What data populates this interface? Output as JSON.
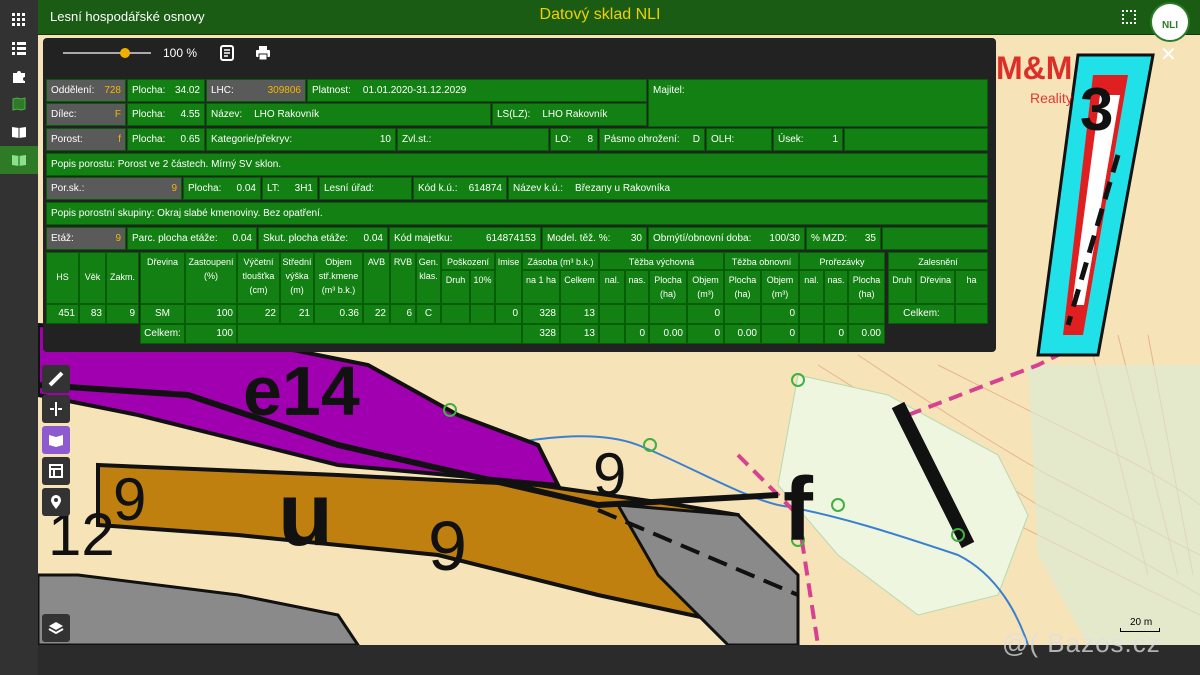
{
  "app": {
    "title": "Lesní hospodářské osnovy",
    "center_title": "Datový sklad NLI",
    "logo_text": "NLI",
    "colors": {
      "accent": "#138013",
      "title": "#f0d000",
      "value": "#f0b800"
    }
  },
  "sidebar": {
    "items": [
      {
        "name": "apps",
        "icon": "grid-icon"
      },
      {
        "name": "list",
        "icon": "list-icon"
      },
      {
        "name": "plugins",
        "icon": "puzzle-icon"
      },
      {
        "name": "map",
        "icon": "map-icon"
      },
      {
        "name": "book",
        "icon": "book-icon"
      },
      {
        "name": "osnovy",
        "icon": "open-book-icon",
        "active": true
      }
    ]
  },
  "dialog": {
    "zoom_label": "100 %",
    "zoom_level": 0.7,
    "close_label": "✕"
  },
  "info": {
    "oddeleni": {
      "label": "Oddělení:",
      "value": "728"
    },
    "plocha1": {
      "label": "Plocha:",
      "value": "34.02"
    },
    "lhc": {
      "label": "LHC:",
      "value": "309806"
    },
    "platnost": {
      "label": "Platnost:",
      "value": "01.01.2020-31.12.2029"
    },
    "majitel": {
      "label": "Majitel:"
    },
    "dilec": {
      "label": "Dílec:",
      "value": "F"
    },
    "plocha2": {
      "label": "Plocha:",
      "value": "4.55"
    },
    "nazev": {
      "label": "Název:",
      "value": "LHO Rakovník"
    },
    "lslz": {
      "label": "LS(LZ):",
      "value": "LHO Rakovník"
    },
    "porost": {
      "label": "Porost:",
      "value": "f"
    },
    "plocha3": {
      "label": "Plocha:",
      "value": "0.65"
    },
    "kategorie": {
      "label": "Kategorie/překryv:",
      "value": "10"
    },
    "zvlst": {
      "label": "Zvl.st.:"
    },
    "lo": {
      "label": "LO:",
      "value": "8"
    },
    "pasmo": {
      "label": "Pásmo ohrožení:",
      "value": "D"
    },
    "olh": {
      "label": "OLH:"
    },
    "usek": {
      "label": "Úsek:",
      "value": "1"
    },
    "popis_porostu": {
      "label": "Popis porostu:",
      "value": "Porost ve 2 částech. Mírný SV sklon."
    },
    "porsk": {
      "label": "Por.sk.:",
      "value": "9"
    },
    "plocha4": {
      "label": "Plocha:",
      "value": "0.04"
    },
    "lt": {
      "label": "LT:",
      "value": "3H1"
    },
    "lesni_urad": {
      "label": "Lesní úřad:"
    },
    "kod_ku": {
      "label": "Kód k.ú.:",
      "value": "614874"
    },
    "nazev_ku": {
      "label": "Název k.ú.:",
      "value": "Březany u Rakovníka"
    },
    "popis_skupiny": {
      "label": "Popis porostní skupiny:",
      "value": "Okraj slabé kmenoviny. Bez opatření."
    },
    "etaz": {
      "label": "Etáž:",
      "value": "9"
    },
    "parc_plocha": {
      "label": "Parc. plocha etáže:",
      "value": "0.04"
    },
    "skut_plocha": {
      "label": "Skut. plocha etáže:",
      "value": "0.04"
    },
    "kod_majetku": {
      "label": "Kód majetku:",
      "value": "614874153"
    },
    "model_tez": {
      "label": "Model. těž. %:",
      "value": "30"
    },
    "obmyti": {
      "label": "Obmýtí/obnovní doba:",
      "value": "100/30"
    },
    "mzd": {
      "label": "% MZD:",
      "value": "35"
    }
  },
  "table": {
    "headers": {
      "hs": "HS",
      "vek": "Věk",
      "zakm": "Zakm.",
      "drevina": "Dřevina",
      "zastoupeni": "Zastoupení (%)",
      "vycetni": "Výčetní tloušťka (cm)",
      "stredni": "Střední výška (m)",
      "objem": "Objem stř.kmene (m³ b.k.)",
      "avb": "AVB",
      "rvb": "RVB",
      "gen": "Gen. klas.",
      "poskozeni": "Poškození",
      "druh": "Druh",
      "pct10": "10%",
      "imise": "Imise",
      "zasoba": "Zásoba (m³ b.k.)",
      "na1ha": "na 1 ha",
      "celkem": "Celkem",
      "tezba_vych": "Těžba výchovná",
      "nal": "nal.",
      "nas": "nas.",
      "plocha_ha": "Plocha (ha)",
      "objem_m3": "Objem (m³)",
      "tezba_obn": "Těžba obnovní",
      "prorezavky": "Prořezávky",
      "zalesneni": "Zalesnění",
      "druh2": "Druh",
      "drevina2": "Dřevina",
      "ha": "ha"
    },
    "hs_row": {
      "hs": "451",
      "vek": "83",
      "zakm": "9"
    },
    "row": {
      "drevina": "SM",
      "zastoupeni": "100",
      "vycetni": "22",
      "stredni": "21",
      "objem": "0.36",
      "avb": "22",
      "rvb": "6",
      "gen": "C",
      "imise": "0",
      "na1ha": "328",
      "celkem": "13",
      "tv_objem": "0",
      "to_objem": "0"
    },
    "total": {
      "label": "Celkem:",
      "zastoupeni": "100",
      "na1ha": "328",
      "celkem": "13",
      "tv_nas": "0",
      "tv_plocha": "0.00",
      "tv_objem": "0",
      "to_plocha": "0.00",
      "to_objem": "0",
      "pr_nas": "0",
      "pr_plocha": "0.00",
      "zal_label": "Celkem:"
    }
  },
  "map": {
    "labels": {
      "e14": "e14",
      "u": "u",
      "nine_a": "9",
      "nine_b": "9",
      "f": "f",
      "nine_c": "9",
      "twelve": "12",
      "three": "3"
    },
    "scale_label": "20 m",
    "watermark": "@( Bazos.cz",
    "brand": "M&M",
    "brand_sub": "Reality"
  }
}
